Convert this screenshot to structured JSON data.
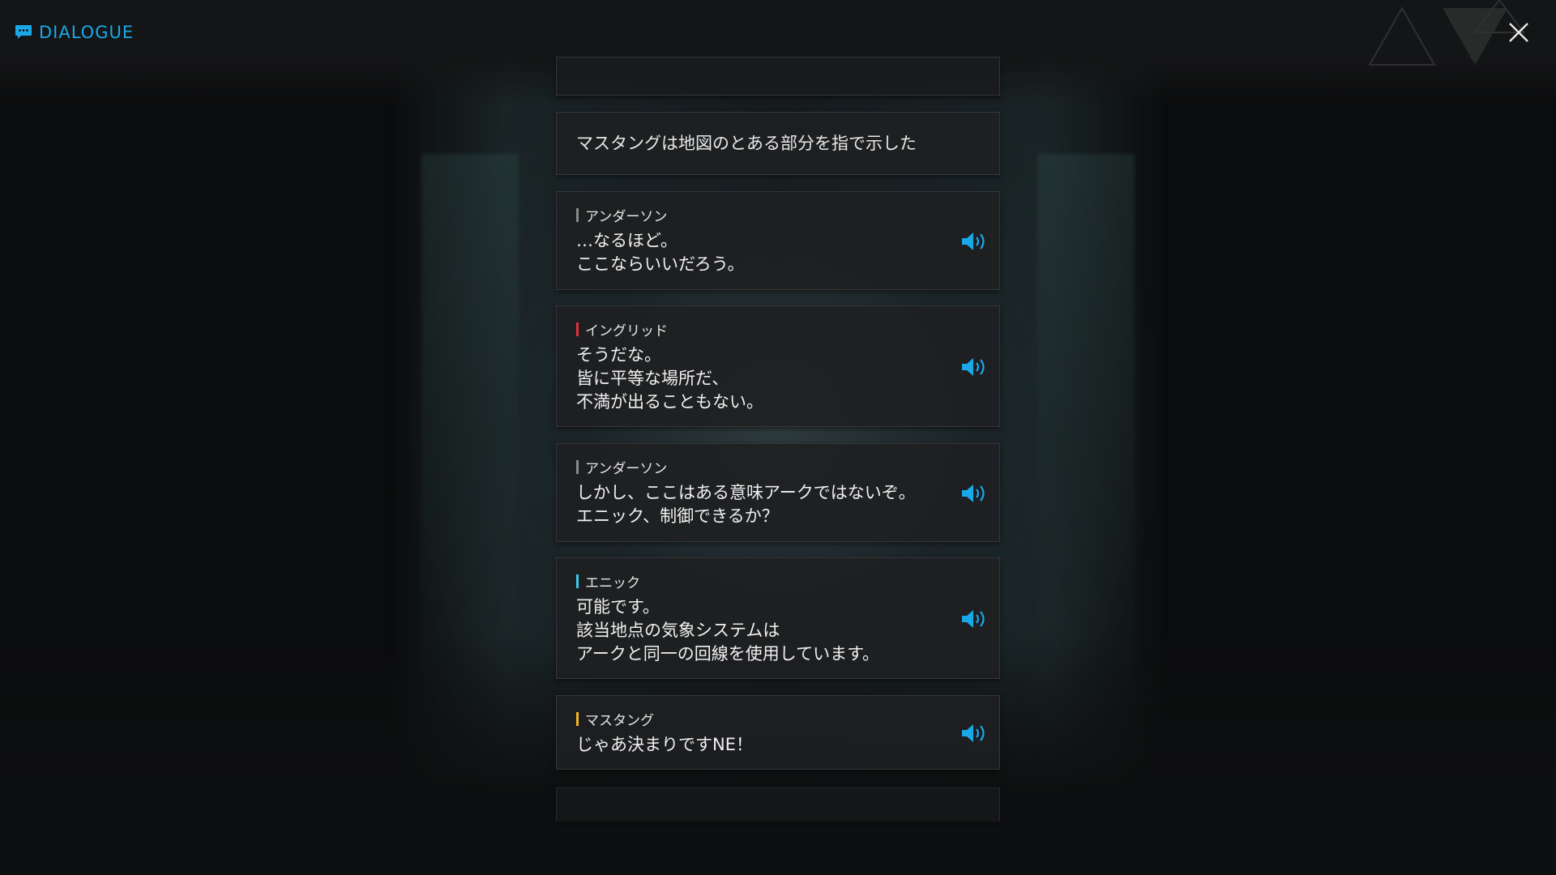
{
  "header": {
    "title": "DIALOGUE",
    "icon": "chat-icon",
    "accent_color": "#1aa8e8"
  },
  "close": {
    "icon": "close-icon"
  },
  "narration": {
    "text": "マスタングは地図のとある部分を指で示した"
  },
  "entries": [
    {
      "speaker": "アンダーソン",
      "speaker_color": "#8a8a8a",
      "lines": [
        "…なるほど。",
        "ここならいいだろう。"
      ],
      "voice_icon": "speaker-icon"
    },
    {
      "speaker": "イングリッド",
      "speaker_color": "#e0323c",
      "lines": [
        "そうだな。",
        "皆に平等な場所だ、",
        "不満が出ることもない。"
      ],
      "voice_icon": "speaker-icon"
    },
    {
      "speaker": "アンダーソン",
      "speaker_color": "#8a8a8a",
      "lines": [
        "しかし、ここはある意味アークではないぞ。",
        "エニック、制御できるか？"
      ],
      "voice_icon": "speaker-icon"
    },
    {
      "speaker": "エニック",
      "speaker_color": "#3cc8e8",
      "lines": [
        "可能です。",
        "該当地点の気象システムは",
        "アークと同一の回線を使用しています。"
      ],
      "voice_icon": "speaker-icon"
    },
    {
      "speaker": "マスタング",
      "speaker_color": "#f0b428",
      "lines": [
        "じゃあ決まりですNE！"
      ],
      "voice_icon": "speaker-icon"
    }
  ]
}
